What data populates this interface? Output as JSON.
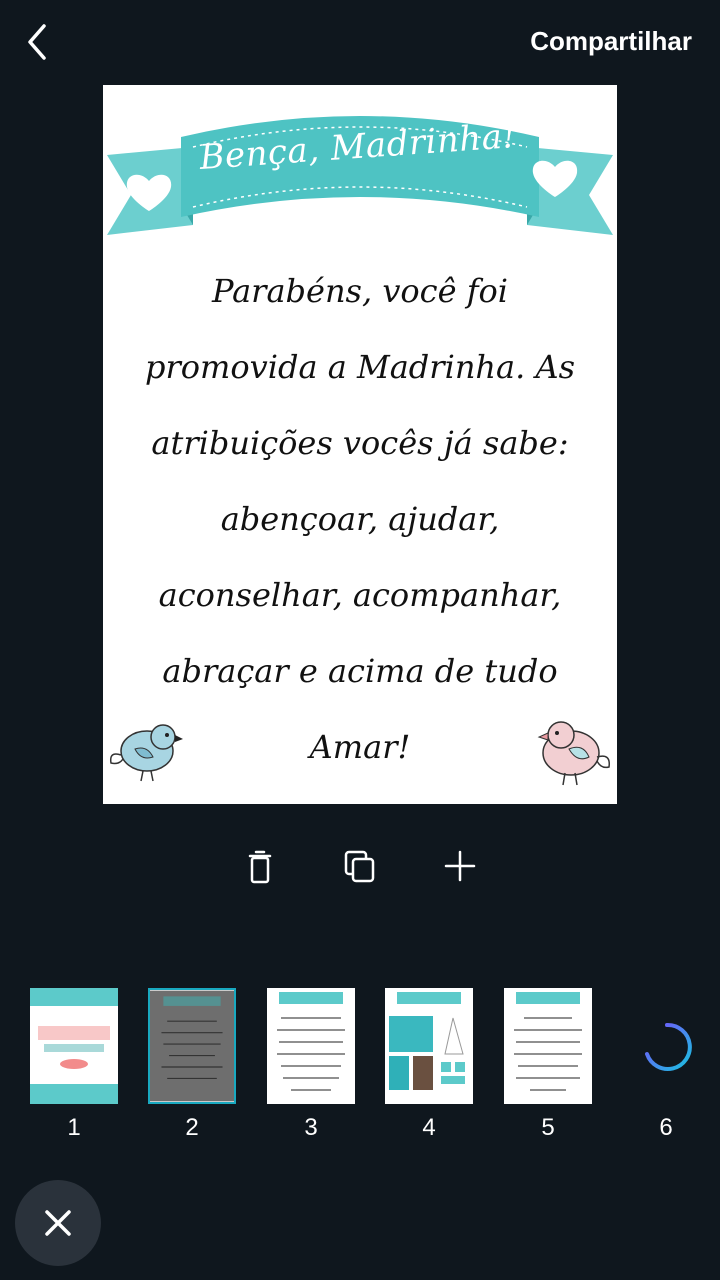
{
  "header": {
    "share_label": "Compartilhar"
  },
  "page": {
    "ribbon_title": "Bença, Madrinha!",
    "body_text": "Parabéns, você foi promovida a Madrinha. As atribuições vocês já sabe: abençoar, ajudar, aconselhar, acompanhar, abraçar e acima de tudo Amar!",
    "accent_color": "#4ec3c3"
  },
  "thumbnails": [
    {
      "number": "1",
      "selected": false
    },
    {
      "number": "2",
      "selected": true
    },
    {
      "number": "3",
      "selected": false
    },
    {
      "number": "4",
      "selected": false
    },
    {
      "number": "5",
      "selected": false
    },
    {
      "number": "6",
      "loading": true
    }
  ],
  "icons": {
    "back": "chevron-left-icon",
    "delete": "trash-icon",
    "duplicate": "copy-icon",
    "add": "plus-icon",
    "close": "close-icon",
    "loading": "spinner-icon"
  },
  "colors": {
    "background": "#0f171e",
    "accent": "#4ec3c3",
    "selection": "#19a9c0",
    "close_button": "#2a323b"
  }
}
